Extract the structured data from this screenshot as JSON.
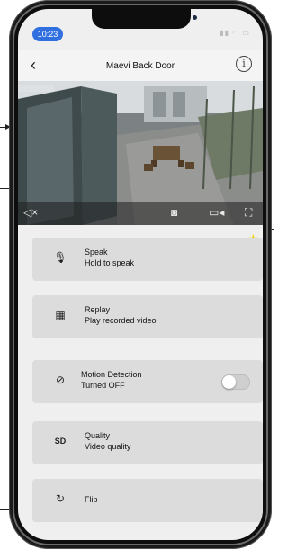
{
  "status_bar": {
    "time": "10:23"
  },
  "header": {
    "title": "Maevi Back Door",
    "back_icon": "chevron-left-icon",
    "info_icon": "info-icon"
  },
  "video_controls": [
    "mute-icon",
    "camera-icon",
    "video-record-icon",
    "fullscreen-icon"
  ],
  "favorite_icon": "star-icon",
  "favorite_color": "#f2d21a",
  "accent_color": "#2f6fe0",
  "rows": [
    {
      "icon": "microphone-icon",
      "title": "Speak",
      "subtitle": "Hold to speak"
    },
    {
      "icon": "calendar-replay-icon",
      "title": "Replay",
      "subtitle": "Play recorded video"
    },
    {
      "icon": "motion-off-icon",
      "title": "Motion Detection",
      "subtitle": "Turned OFF",
      "toggle": false
    },
    {
      "icon": "sd-icon",
      "icon_text": "SD",
      "title": "Quality",
      "subtitle": "Video quality"
    },
    {
      "icon": "flip-icon",
      "title": "Flip"
    }
  ]
}
